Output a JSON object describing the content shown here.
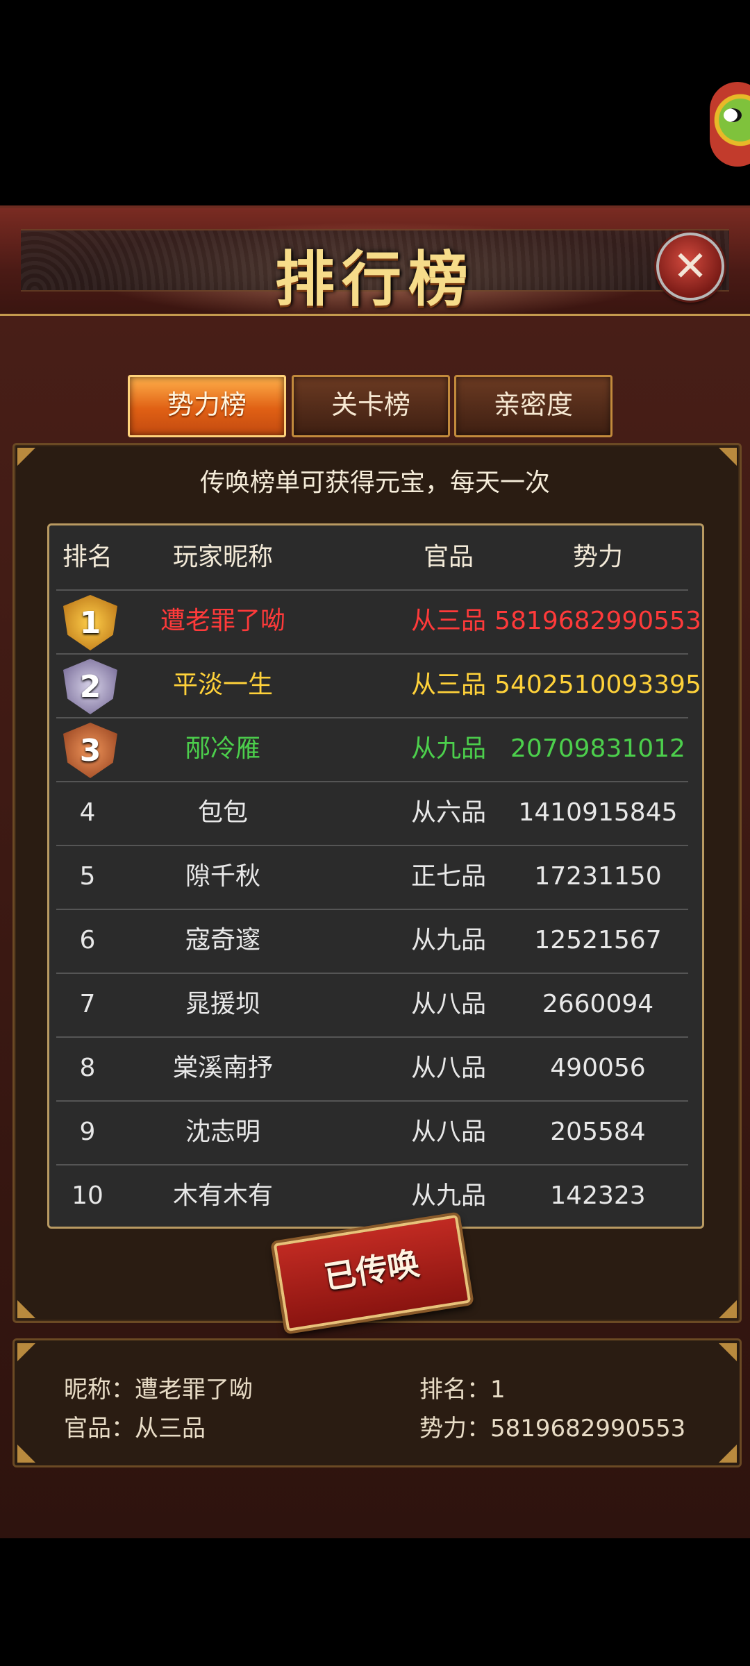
{
  "title": "排行榜",
  "tabs": [
    {
      "label": "势力榜",
      "active": true
    },
    {
      "label": "关卡榜",
      "active": false
    },
    {
      "label": "亲密度",
      "active": false
    }
  ],
  "notice": "传唤榜单可获得元宝，每天一次",
  "table": {
    "headers": [
      "排名",
      "玩家昵称",
      "官品",
      "势力"
    ],
    "rows": [
      {
        "rank": "1",
        "name": "遭老罪了呦",
        "title": "从三品",
        "power": "5819682990553"
      },
      {
        "rank": "2",
        "name": "平淡一生",
        "title": "从三品",
        "power": "5402510093395"
      },
      {
        "rank": "3",
        "name": "邴冷雁",
        "title": "从九品",
        "power": "20709831012"
      },
      {
        "rank": "4",
        "name": "包包",
        "title": "从六品",
        "power": "1410915845"
      },
      {
        "rank": "5",
        "name": "隙千秋",
        "title": "正七品",
        "power": "17231150"
      },
      {
        "rank": "6",
        "name": "寇奇邃",
        "title": "从九品",
        "power": "12521567"
      },
      {
        "rank": "7",
        "name": "晁援坝",
        "title": "从八品",
        "power": "2660094"
      },
      {
        "rank": "8",
        "name": "棠溪南抒",
        "title": "从八品",
        "power": "490056"
      },
      {
        "rank": "9",
        "name": "沈志明",
        "title": "从八品",
        "power": "205584"
      },
      {
        "rank": "10",
        "name": "木有木有",
        "title": "从九品",
        "power": "142323"
      }
    ]
  },
  "summon_button": "已传唤",
  "my_info": {
    "nickname_label": "昵称：",
    "nickname": "遭老罪了呦",
    "rank_label": "排名：",
    "rank": "1",
    "title_label": "官品：",
    "title": "从三品",
    "power_label": "势力：",
    "power": "5819682990553"
  },
  "icons": {
    "close": "close-icon",
    "avatar": "frog-avatar-icon"
  },
  "colors": {
    "rank1": "#ff3a3a",
    "rank2": "#ffd23a",
    "rank3": "#4ccf4c",
    "active_tab": "#e06014"
  }
}
